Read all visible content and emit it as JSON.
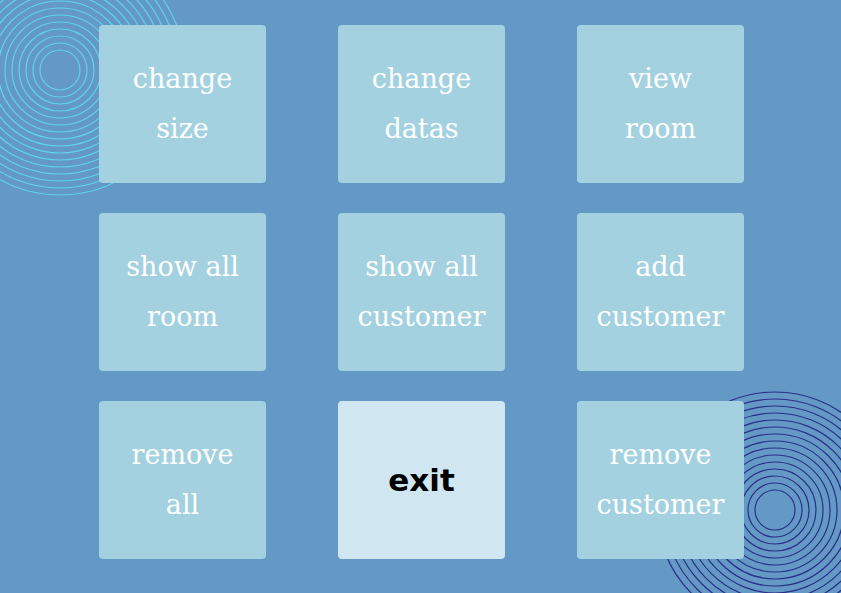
{
  "buttons": [
    {
      "lines": [
        "change",
        "size"
      ],
      "selected": false
    },
    {
      "lines": [
        "change",
        "datas"
      ],
      "selected": false
    },
    {
      "lines": [
        "view",
        "room"
      ],
      "selected": false
    },
    {
      "lines": [
        "show all",
        "room"
      ],
      "selected": false
    },
    {
      "lines": [
        "show all",
        "customer"
      ],
      "selected": false
    },
    {
      "lines": [
        "add",
        "customer"
      ],
      "selected": false
    },
    {
      "lines": [
        "remove",
        "all"
      ],
      "selected": false
    },
    {
      "lines": [
        "exit"
      ],
      "selected": true
    },
    {
      "lines": [
        "remove",
        "customer"
      ],
      "selected": false
    }
  ]
}
